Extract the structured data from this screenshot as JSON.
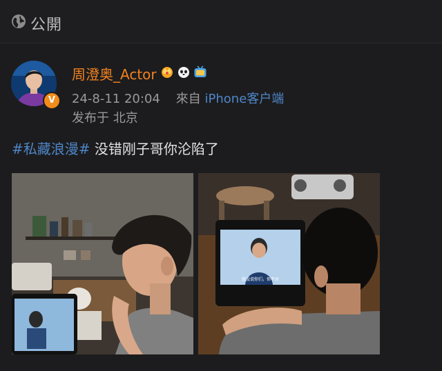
{
  "header": {
    "visibility_icon": "globe-icon",
    "visibility_label": "公開"
  },
  "post": {
    "author": {
      "name": "周澄奥_Actor",
      "avatar": "avatar",
      "verified_badge": "v-verified-icon",
      "badge_icons": [
        "crown-badge-icon",
        "panda-badge-icon",
        "tv-badge-icon"
      ]
    },
    "date": "24-8-11 20:04",
    "source_prefix": "來自",
    "source_device": "iPhone客户端",
    "location": "发布于 北京",
    "hashtag": "#私藏浪漫#",
    "text": " 没错刚子哥你沦陷了",
    "images": [
      {
        "name": "photo-man-watching-tablet-side-view"
      },
      {
        "name": "photo-man-watching-tablet-back-view",
        "subtitle": "我没说你们，但不对"
      }
    ]
  },
  "colors": {
    "background": "#1c1c1e",
    "username": "#f2821f",
    "link": "#4e86c8",
    "meta": "#9a9a9a",
    "verified": "#f28c1a"
  }
}
